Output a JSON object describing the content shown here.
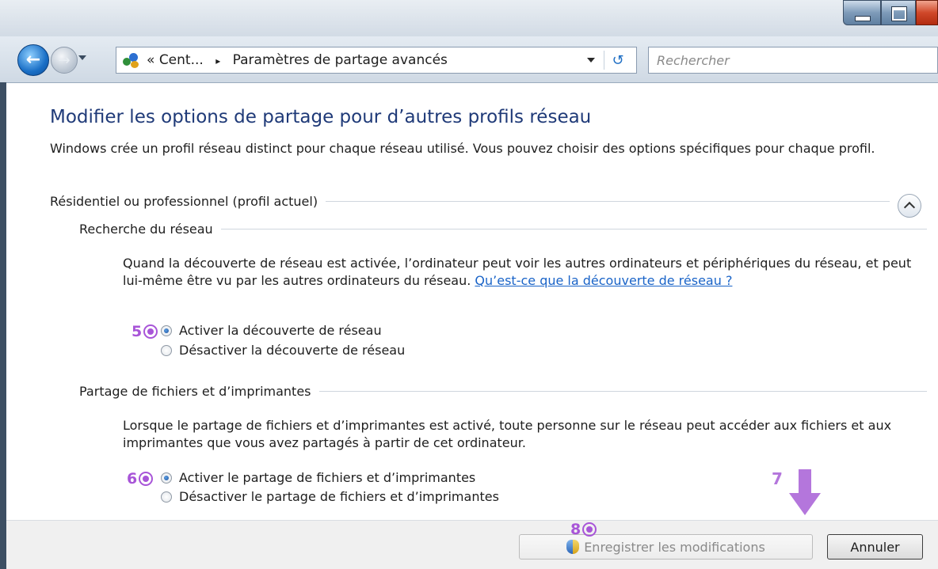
{
  "address": {
    "path_prefix": "«",
    "crumb_1": "Cent...",
    "crumb_sep": "▸",
    "crumb_2": "Paramètres de partage avancés",
    "refresh_glyph": "↺"
  },
  "search": {
    "placeholder": "Rechercher"
  },
  "page": {
    "title": "Modifier les options de partage pour d’autres profils réseau",
    "intro": "Windows crée un profil réseau distinct pour chaque réseau utilisé. Vous pouvez choisir des options spécifiques pour chaque profil."
  },
  "profile": {
    "header": "Résidentiel ou professionnel (profil actuel)",
    "network_discovery": {
      "header": "Recherche du réseau",
      "description": "Quand la découverte de réseau est activée, l’ordinateur peut voir les autres ordinateurs et périphériques du réseau, et peut lui-même être vu par les autres ordinateurs du réseau.",
      "link": "Qu’est-ce que la découverte de réseau ?",
      "option_on": "Activer la découverte de réseau",
      "option_off": "Désactiver la découverte de réseau",
      "selected": "on"
    },
    "file_sharing": {
      "header": "Partage de fichiers et d’imprimantes",
      "description": "Lorsque le partage de fichiers et d’imprimantes est activé, toute personne sur le réseau peut accéder aux fichiers et aux imprimantes que vous avez partagés à partir de cet ordinateur.",
      "option_on": "Activer le partage de fichiers et d’imprimantes",
      "option_off": "Désactiver le partage de fichiers et d’imprimantes",
      "selected": "on"
    }
  },
  "annotations": {
    "m5": "5",
    "m6": "6",
    "m7": "7",
    "m8": "8",
    "color": "#a855d8"
  },
  "buttons": {
    "save": "Enregistrer les modifications",
    "cancel": "Annuler"
  }
}
